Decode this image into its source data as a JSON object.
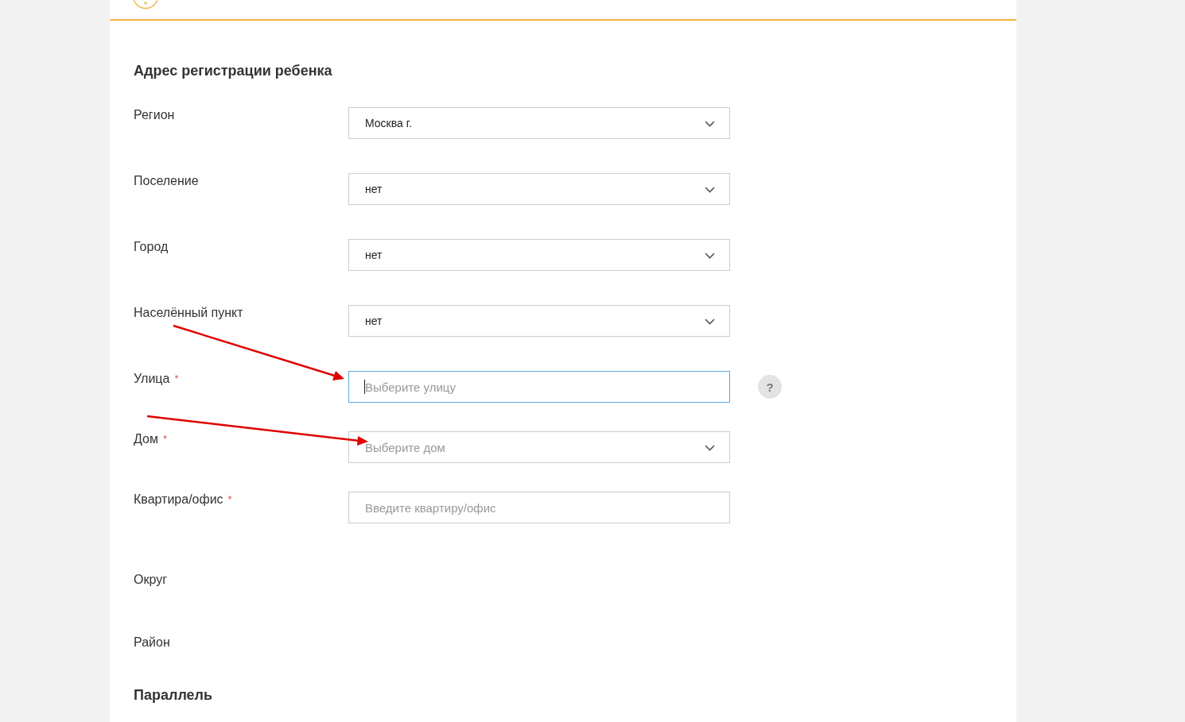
{
  "section_title": "Адрес регистрации ребенка",
  "fields": [
    {
      "label": "Регион",
      "kind": "select",
      "value": "Москва г.",
      "focused": false
    },
    {
      "label": "Поселение",
      "kind": "select",
      "value": "нет",
      "focused": false
    },
    {
      "label": "Город",
      "kind": "select",
      "value": "нет",
      "focused": false
    },
    {
      "label": "Населённый пункт",
      "kind": "select",
      "value": "нет",
      "focused": false
    },
    {
      "label": "Улица",
      "required_mark": "*",
      "kind": "input",
      "placeholder": "Выберите улицу",
      "focused": true,
      "help": "?"
    },
    {
      "label": "Дом",
      "required_mark": "*",
      "kind": "select",
      "placeholder": "Выберите дом",
      "focused": false
    },
    {
      "label": "Квартира/офис",
      "required_mark": "*",
      "kind": "input",
      "placeholder": "Введите квартиру/офис",
      "focused": false
    },
    {
      "label": "Округ",
      "kind": "none"
    },
    {
      "label": "Район",
      "kind": "none"
    }
  ],
  "next_section_title": "Параллель"
}
